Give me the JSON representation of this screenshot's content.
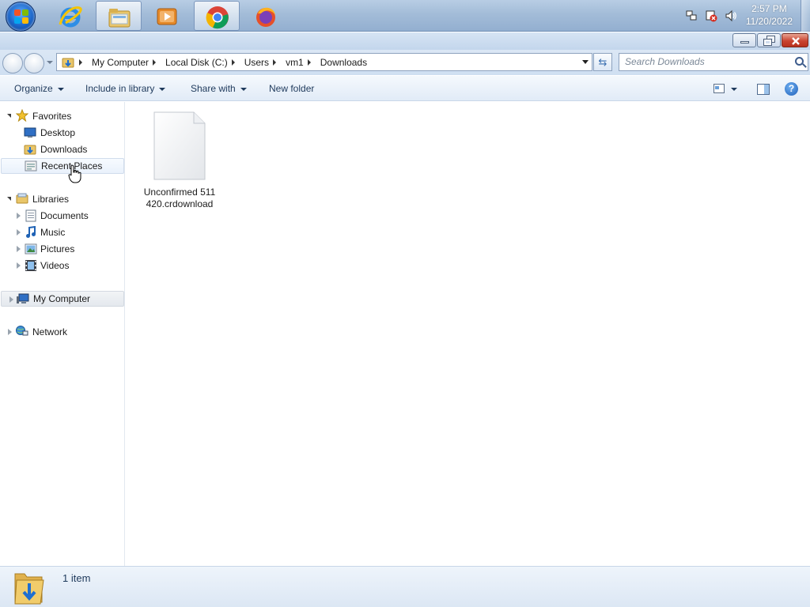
{
  "taskbar": {
    "clock_time": "2:57 PM",
    "clock_date": "11/20/2022",
    "apps": [
      "internet-explorer",
      "windows-explorer",
      "media-player",
      "chrome",
      "firefox"
    ]
  },
  "breadcrumb": [
    "My Computer",
    "Local Disk (C:)",
    "Users",
    "vm1",
    "Downloads"
  ],
  "search": {
    "placeholder": "Search Downloads"
  },
  "commands": {
    "organize": "Organize",
    "include_in_library": "Include in library",
    "share_with": "Share with",
    "new_folder": "New folder"
  },
  "nav": {
    "favorites": "Favorites",
    "favorites_items": [
      "Desktop",
      "Downloads",
      "Recent Places"
    ],
    "libraries": "Libraries",
    "libraries_items": [
      "Documents",
      "Music",
      "Pictures",
      "Videos"
    ],
    "computer": "My Computer",
    "network": "Network"
  },
  "files": [
    {
      "name": "Unconfirmed 511420.crdownload"
    }
  ],
  "details": {
    "count": "1 item"
  },
  "colors": {
    "accent": "#1e395b",
    "taskbar": "#a3bcd8",
    "close": "#c94430"
  }
}
